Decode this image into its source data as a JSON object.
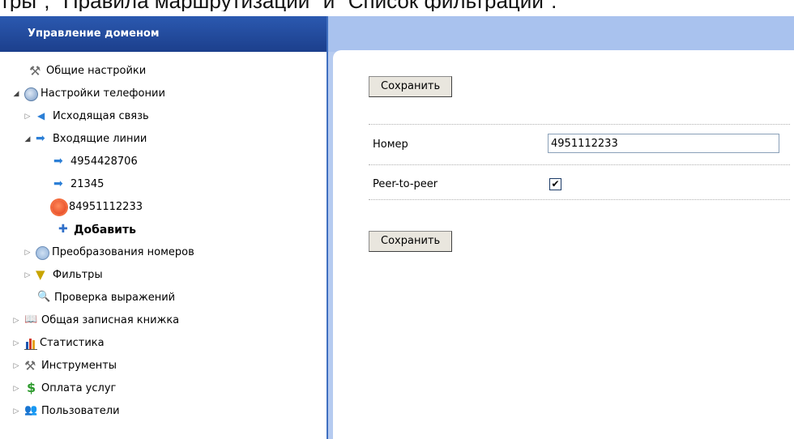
{
  "top_caption": "тры\", \"Правила маршрутизации\" и \"Список фильтрации\".",
  "sidebar": {
    "title": "Управление доменом",
    "items": [
      {
        "label": "Общие настройки",
        "icon": "tools-icon",
        "expander": "none"
      },
      {
        "label": "Настройки телефонии",
        "icon": "phone-settings-icon",
        "expander": "open"
      },
      {
        "label": "Исходящая связь",
        "icon": "arrow-left-icon",
        "expander": "closed"
      },
      {
        "label": "Входящие линии",
        "icon": "arrow-right-icon",
        "expander": "open"
      },
      {
        "label": "4954428706",
        "icon": "arrow-right-icon",
        "expander": "none"
      },
      {
        "label": "21345",
        "icon": "arrow-right-icon",
        "expander": "none"
      },
      {
        "label": "84951112233",
        "icon": "red-burst-icon",
        "expander": "none"
      },
      {
        "label": "Добавить",
        "icon": "plus-icon",
        "expander": "none"
      },
      {
        "label": "Преобразования номеров",
        "icon": "conversion-icon",
        "expander": "closed"
      },
      {
        "label": "Фильтры",
        "icon": "filter-icon",
        "expander": "closed"
      },
      {
        "label": "Проверка выражений",
        "icon": "search-icon",
        "expander": "none"
      },
      {
        "label": "Общая записная книжка",
        "icon": "book-icon",
        "expander": "closed"
      },
      {
        "label": "Статистика",
        "icon": "statistics-icon",
        "expander": "closed"
      },
      {
        "label": "Инструменты",
        "icon": "tools-icon",
        "expander": "closed"
      },
      {
        "label": "Оплата услуг",
        "icon": "money-icon",
        "expander": "closed"
      },
      {
        "label": "Пользователи",
        "icon": "users-icon",
        "expander": "closed"
      }
    ]
  },
  "form": {
    "save_label": "Сохранить",
    "number_label": "Номер",
    "number_value": "4951112233",
    "p2p_label": "Peer-to-peer",
    "p2p_checked": true,
    "p2p_check_glyph": "✔"
  },
  "colors": {
    "header_blue": "#2b59b0",
    "right_bg": "#b6cbf0"
  }
}
